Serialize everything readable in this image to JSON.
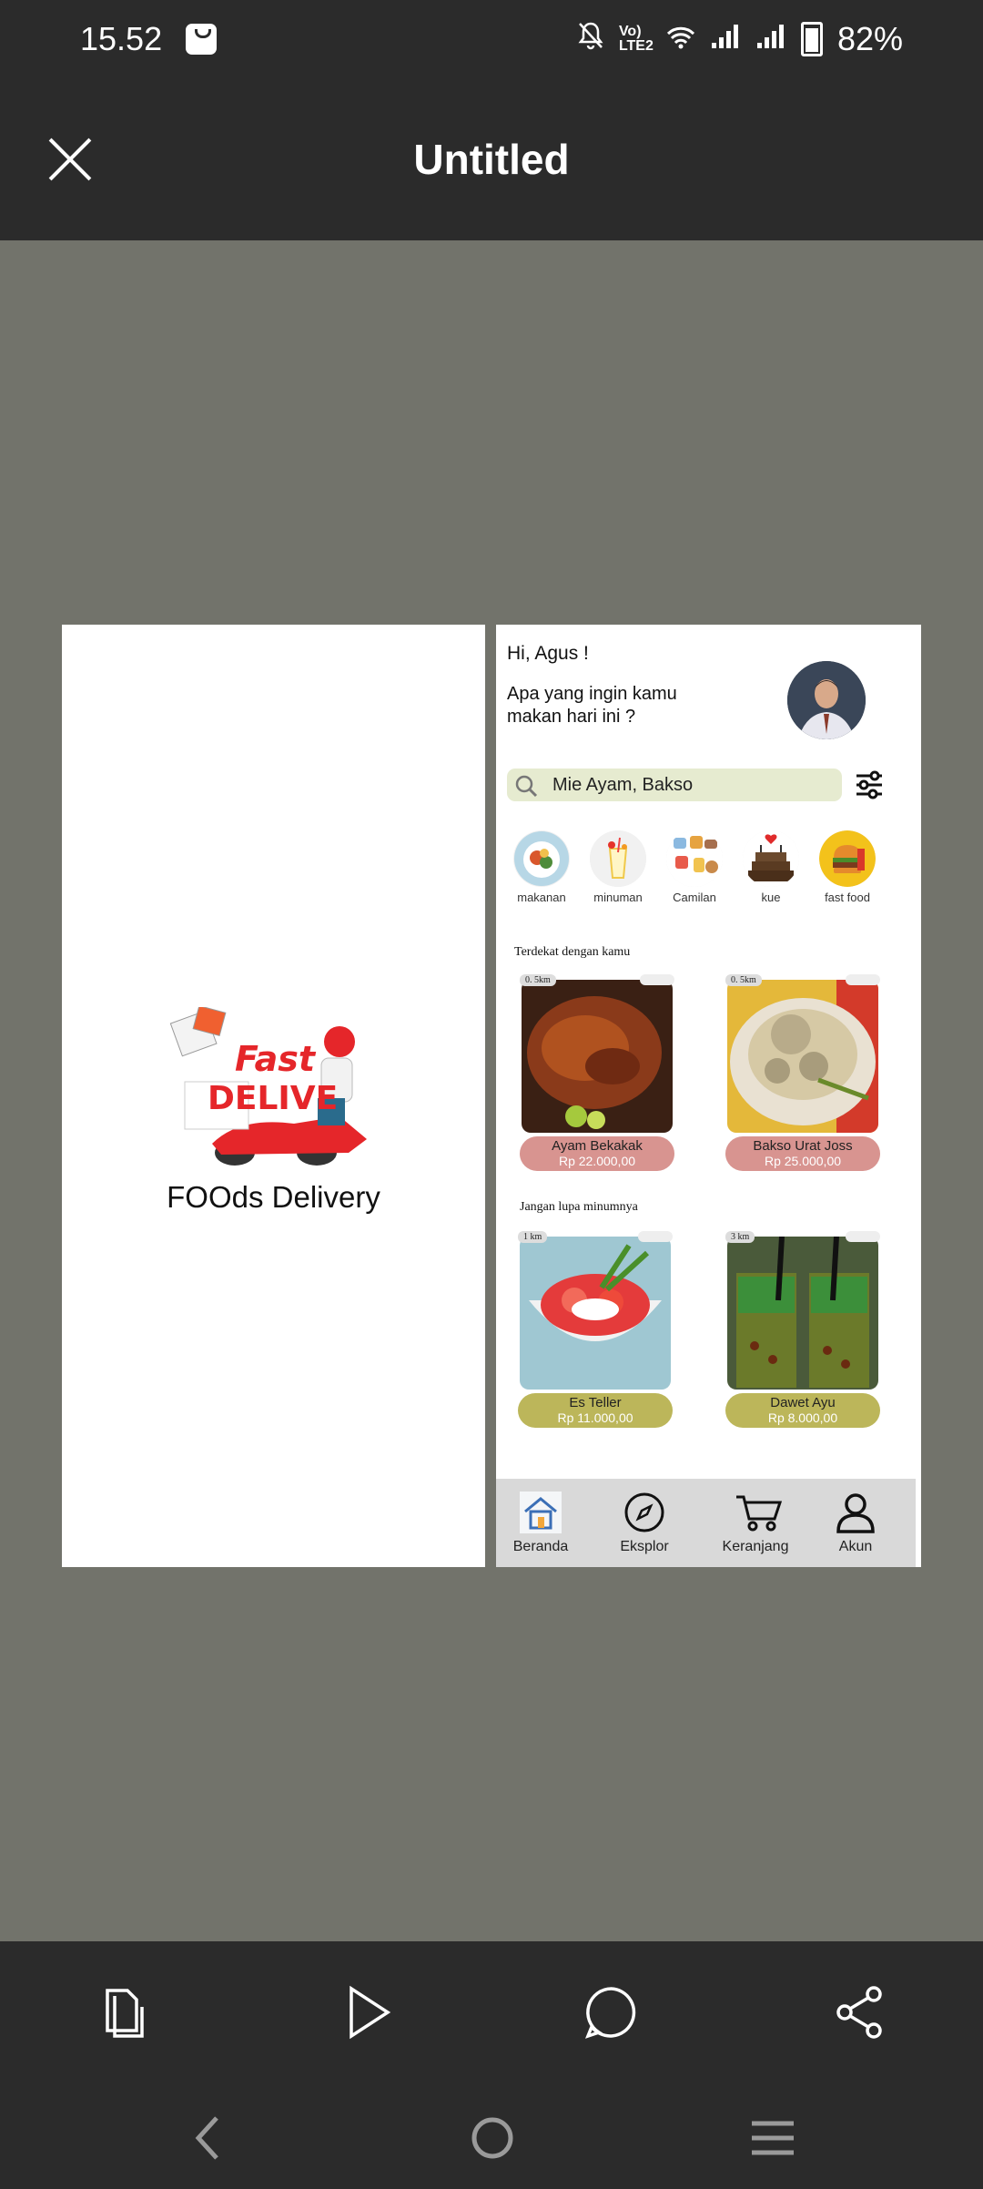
{
  "status": {
    "time": "15.52",
    "lte": "Vo) LTE2",
    "battery": "82%"
  },
  "header": {
    "title": "Untitled"
  },
  "splash": {
    "caption": "FOOds Delivery",
    "logo_text": "Fast DELIVERY"
  },
  "home": {
    "greeting": "Hi, Agus !",
    "question": "Apa yang ingin kamu makan hari ini ?",
    "search_value": "Mie Ayam, Bakso",
    "categories": [
      {
        "label": "makanan",
        "icon": "food-plate-icon"
      },
      {
        "label": "minuman",
        "icon": "drink-icon"
      },
      {
        "label": "Camilan",
        "icon": "snack-icon"
      },
      {
        "label": "kue",
        "icon": "cake-icon"
      },
      {
        "label": "fast food",
        "icon": "burger-icon"
      }
    ],
    "section_nearby": "Terdekat dengan kamu",
    "section_drinks": "Jangan lupa minumnya",
    "foods": [
      {
        "name": "Ayam Bekakak",
        "price": "Rp 22.000,00",
        "distance": "0. 5km"
      },
      {
        "name": "Bakso Urat Joss",
        "price": "Rp 25.000,00",
        "distance": "0. 5km"
      }
    ],
    "drinks": [
      {
        "name": "Es Teller",
        "price": "Rp 11.000,00",
        "distance": "1 km"
      },
      {
        "name": "Dawet Ayu",
        "price": "Rp 8.000,00",
        "distance": "3 km"
      }
    ],
    "tabs": [
      {
        "label": "Beranda",
        "icon": "home-icon"
      },
      {
        "label": "Eksplor",
        "icon": "compass-icon"
      },
      {
        "label": "Keranjang",
        "icon": "cart-icon"
      },
      {
        "label": "Akun",
        "icon": "user-icon"
      }
    ]
  },
  "colors": {
    "pink_pill": "#d89490",
    "olive_pill": "#bcb65a",
    "search_bg": "#e6ebd0",
    "backdrop": "#72736b",
    "chrome": "#2b2b2b"
  }
}
